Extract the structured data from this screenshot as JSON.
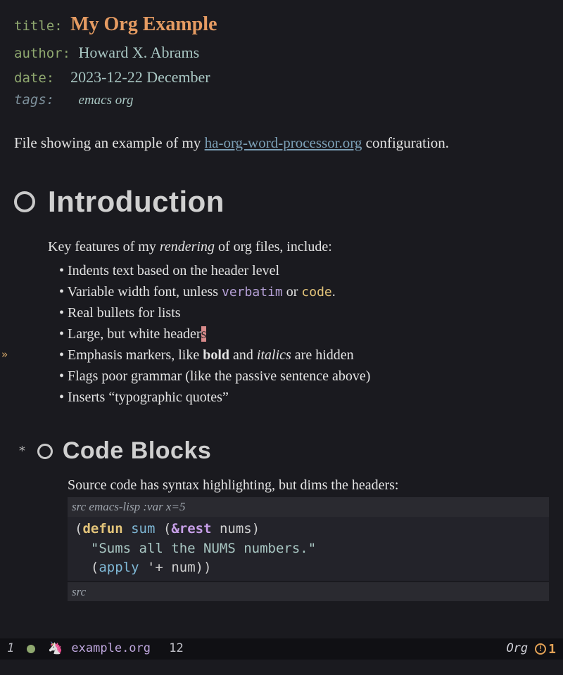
{
  "meta": {
    "title_key": "title:",
    "title": "My Org Example",
    "author_key": "author:",
    "author": "Howard X. Abrams",
    "date_key": "date:",
    "date": "2023-12-22 December",
    "tags_key": "tags:",
    "tags": "emacs org"
  },
  "intro": {
    "before": "File showing an example of my ",
    "link": "ha-org-word-processor.org",
    "after": " configuration."
  },
  "sections": {
    "intro_heading": "Introduction",
    "code_heading": "Code Blocks",
    "lead_a": "Key features of my ",
    "lead_em": "rendering",
    "lead_b": " of org files, include:",
    "bullets": [
      {
        "full": "Indents text based on the header level"
      },
      {
        "a": "Variable width font, unless ",
        "verbatim": "verbatim",
        "b": " or ",
        "code": "code",
        "c": "."
      },
      {
        "full": "Real bullets for lists"
      },
      {
        "a": "Large, but white header",
        "cursor": "s"
      },
      {
        "a": "Emphasis markers, like ",
        "bold": "bold",
        "b": " and ",
        "ital": "italics",
        "c": " are hidden"
      },
      {
        "full": "Flags poor grammar (like the passive sentence above)"
      },
      {
        "full": "Inserts “typographic quotes”"
      }
    ],
    "source_para": "Source code has syntax highlighting, but dims the headers:",
    "src_header_a": "src ",
    "src_header_b": "emacs-lisp :var x=5",
    "src_footer": "src",
    "code": {
      "l1_open": "(",
      "l1_defun": "defun",
      "l1_sp": " ",
      "l1_name": "sum",
      "l1_sp2": " (",
      "l1_rest": "&rest",
      "l1_sp3": " ",
      "l1_var": "nums",
      "l1_close": ")",
      "l2_str": "  \"Sums all the NUMS numbers.\"",
      "l3_a": "  (",
      "l3_apply": "apply",
      "l3_b": " '",
      "l3_plus": "+",
      "l3_c": " num))"
    }
  },
  "gutter_arrow": "»",
  "modeline": {
    "winnum": "1",
    "filename": "example.org",
    "line": "12",
    "mode": "Org",
    "errcount": "1"
  }
}
